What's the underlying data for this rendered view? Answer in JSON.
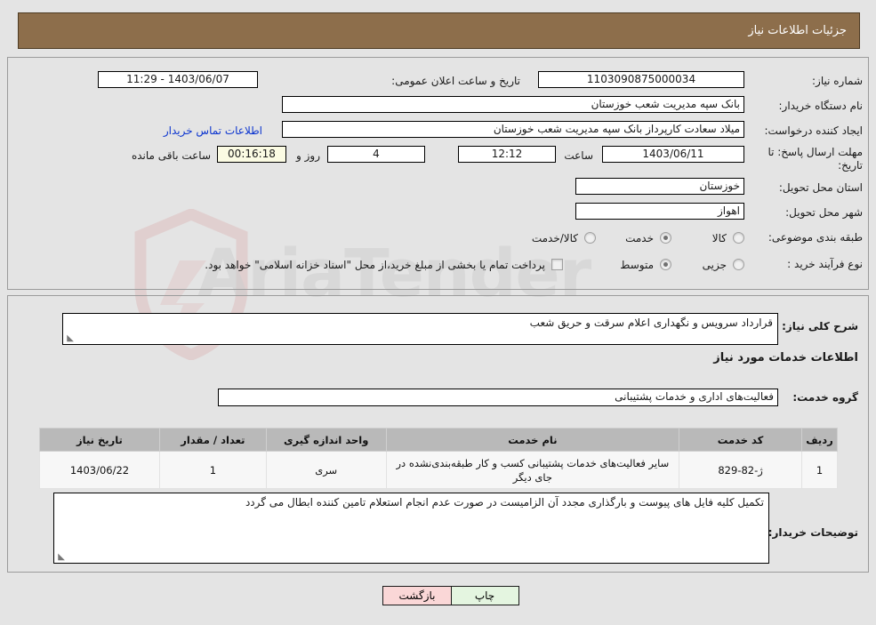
{
  "header": {
    "title": "جزئیات اطلاعات نیاز"
  },
  "watermark": {
    "text": "AriaTender"
  },
  "form": {
    "need_number_label": "شماره نیاز:",
    "need_number_value": "1103090875000034",
    "announce_label": "تاریخ و ساعت اعلان عمومی:",
    "announce_value": "1403/06/07 - 11:29",
    "buyer_org_label": "نام دستگاه خریدار:",
    "buyer_org_value": "بانک سپه مدیریت شعب خوزستان",
    "creator_label": "ایجاد کننده درخواست:",
    "creator_value": "میلاد سعادت کارپرداز بانک سپه مدیریت شعب خوزستان",
    "contact_link": "اطلاعات تماس خریدار",
    "deadline_label": "مهلت ارسال پاسخ: تا تاریخ:",
    "deadline_date": "1403/06/11",
    "hour_label": "ساعت",
    "deadline_time": "12:12",
    "days_value": "4",
    "days_label": "روز و",
    "remaining_time": "00:16:18",
    "remaining_label": "ساعت باقی مانده",
    "province_label": "استان محل تحویل:",
    "province_value": "خوزستان",
    "city_label": "شهر محل تحویل:",
    "city_value": "اهواز",
    "category_label": "طبقه بندی موضوعی:",
    "category_options": [
      "کالا",
      "خدمت",
      "کالا/خدمت"
    ],
    "category_selected": "خدمت",
    "process_label": "نوع فرآیند خرید :",
    "process_options": [
      "جزیی",
      "متوسط"
    ],
    "process_selected": "متوسط",
    "treasury_checkbox_text": "پرداخت تمام یا بخشی از مبلغ خرید،از محل \"اسناد خزانه اسلامی\" خواهد بود.",
    "treasury_checked": false
  },
  "details": {
    "summary_label": "شرح کلی نیاز:",
    "summary_value": "قرارداد سرویس و نگهداری اعلام سرقت و حریق شعب",
    "services_heading": "اطلاعات خدمات مورد نیاز",
    "service_group_label": "گروه خدمت:",
    "service_group_value": "فعالیت‌های اداری و خدمات پشتیبانی",
    "buyer_notes_label": "توضیحات خریدار:",
    "buyer_notes_value": "تکمیل کلیه فایل های پیوست و بارگذاری مجدد آن الزامیست در صورت عدم انجام استعلام تامین کننده ابطال می گردد"
  },
  "table": {
    "headers": [
      "ردیف",
      "کد خدمت",
      "نام خدمت",
      "واحد اندازه گیری",
      "تعداد / مقدار",
      "تاریخ نیاز"
    ],
    "rows": [
      {
        "radif": "1",
        "code": "ژ-82-829",
        "name": "سایر فعالیت‌های خدمات پشتیبانی کسب و کار طبقه‌بندی‌نشده در جای دیگر",
        "unit": "سری",
        "qty": "1",
        "date": "1403/06/22"
      }
    ]
  },
  "buttons": {
    "print": "چاپ",
    "back": "بازگشت"
  },
  "colors": {
    "header_bg": "#8d6e4b",
    "page_bg": "#e4e4e4",
    "link": "#0b34cf",
    "print_bg": "#e4f5e0",
    "back_bg": "#fad7d7",
    "highlight_field": "#fbfbe3"
  }
}
